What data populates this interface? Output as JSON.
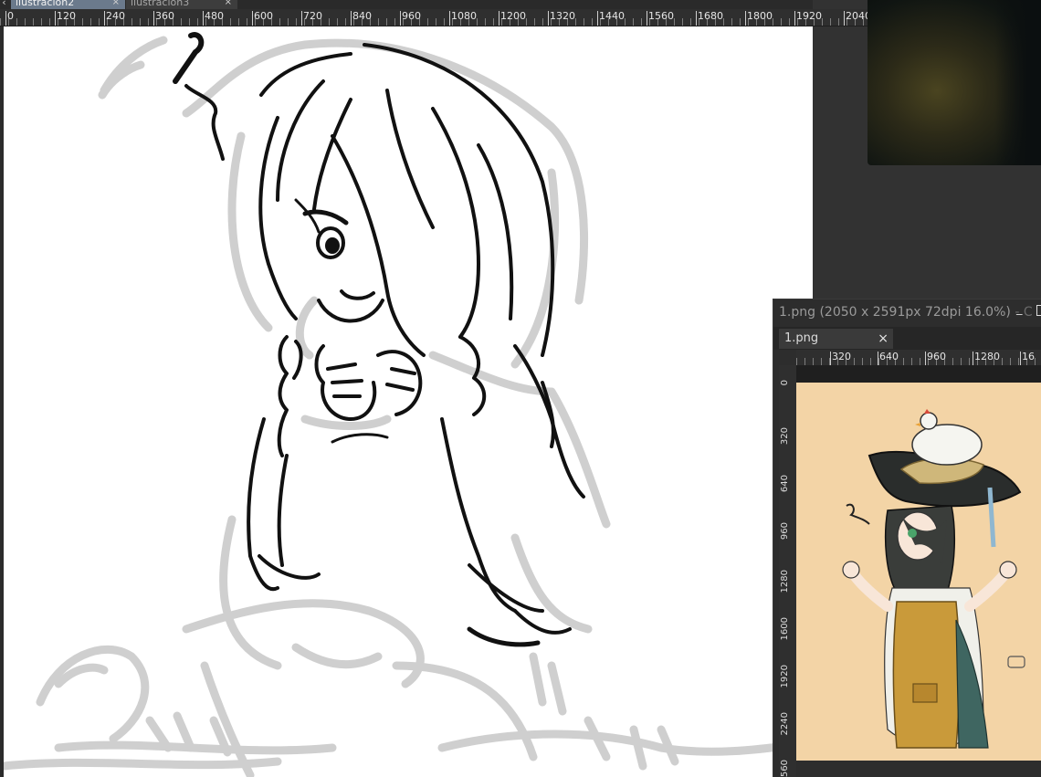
{
  "tabs": {
    "nav_arrow": "‹",
    "active_tab": "ilustración2",
    "inactive_tab": "ilustración3",
    "close_glyph": "×"
  },
  "ruler": {
    "marks": [
      "0",
      "120",
      "240",
      "360",
      "480",
      "600",
      "720",
      "840",
      "960",
      "1080",
      "1200",
      "1320",
      "1440",
      "1560",
      "1680",
      "1800",
      "1920",
      "2040"
    ]
  },
  "reference_window": {
    "title": "1.png (2050 x 2591px 72dpi 16.0%)",
    "title_suffix": "- C",
    "minimize_glyph": "_",
    "tab_label": "1.png",
    "tab_close": "×",
    "ruler_h": [
      "320",
      "640",
      "960",
      "1280",
      "16"
    ],
    "ruler_v": [
      "0",
      "320",
      "640",
      "960",
      "1280",
      "1600",
      "1920",
      "2240",
      "560"
    ]
  },
  "colors": {
    "workspace_bg": "#323232",
    "active_tab": "#6b7a8c",
    "ink": "#111111",
    "sketch": "#cfcfcf",
    "reference_bg": "#f3d4a6"
  },
  "icons": {
    "nav": "chevron-left-icon",
    "close": "close-icon",
    "minimize": "minimize-icon",
    "maximize": "maximize-icon",
    "music_note": "music-note-icon"
  }
}
